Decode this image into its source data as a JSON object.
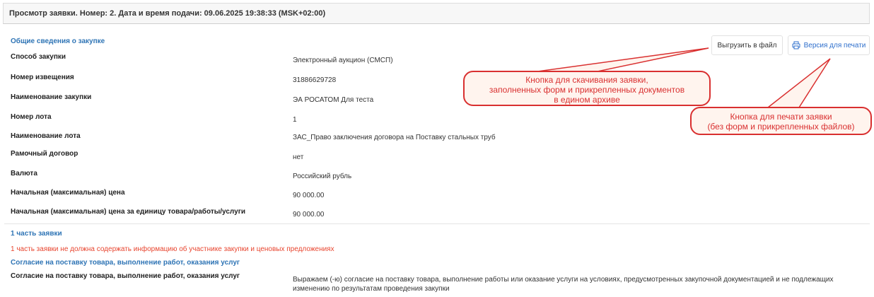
{
  "header": {
    "title": "Просмотр заявки. Номер: 2. Дата и время подачи: 09.06.2025 19:38:33 (MSK+02:00)"
  },
  "general": {
    "heading": "Общие сведения о закупке",
    "rows": [
      {
        "label": "Способ закупки",
        "value": "Электронный аукцион (СМСП)"
      },
      {
        "label": "Номер извещения",
        "value": "31886629728"
      },
      {
        "label": "Наименование закупки",
        "value": "ЭА РОСАТОМ Для теста"
      },
      {
        "label": "Номер лота",
        "value": "1"
      },
      {
        "label": "Наименование лота",
        "value": "ЗАС_Право заключения договора на Поставку стальных труб"
      },
      {
        "label": "Рамочный договор",
        "value": "нет"
      },
      {
        "label": "Валюта",
        "value": "Российский рубль"
      },
      {
        "label": "Начальная (максимальная) цена",
        "value": "90 000.00"
      },
      {
        "label": "Начальная (максимальная) цена за единицу товара/работы/услуги",
        "value": "90 000.00"
      }
    ]
  },
  "toolbar": {
    "export_label": "Выгрузить в файл",
    "print_label": "Версия для печати"
  },
  "callouts": {
    "export_line1": "Кнопка для скачивания заявки,",
    "export_line2": "заполненных форм и прикрепленных документов",
    "export_line3": "в едином архиве",
    "print_line1": "Кнопка для печати заявки",
    "print_line2": "(без форм и прикрепленных файлов)"
  },
  "part1": {
    "heading": "1 часть заявки",
    "warning": "1 часть заявки не должна содержать информацию об участнике закупки и ценовых предложениях",
    "subheading": "Согласие на поставку товара, выполнение работ, оказания услуг",
    "consent_label": "Согласие на поставку товара, выполнение работ, оказания услуг",
    "consent_value": "Выражаем (-ю) согласие на поставку товара, выполнение работы или оказание услуги на условиях, предусмотренных закупочной документацией и не подлежащих изменению по результатам проведения закупки"
  },
  "colors": {
    "accent": "#2e74b5",
    "warning": "#e8452f",
    "callout": "#d93030"
  },
  "icons": {
    "print": "printer-icon"
  }
}
